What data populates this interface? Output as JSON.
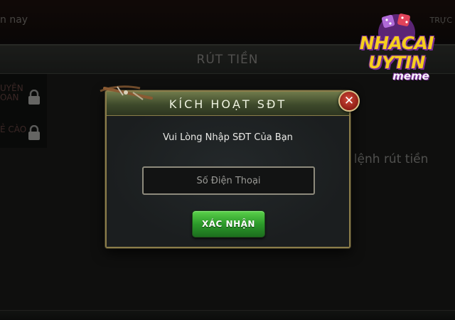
{
  "background": {
    "top_left_text": "n nay",
    "top_right_text": "TRỰC",
    "top_center_text": "",
    "withdraw_title": "RÚT TIỀN",
    "side_menu": [
      {
        "label": "UYÊN\nOAN",
        "icon": "lock-icon"
      },
      {
        "label": "Ẻ CÀO",
        "icon": "lock-icon"
      }
    ],
    "body_text": "o lệnh rút tiền"
  },
  "dialog": {
    "title": "KÍCH HOẠT SĐT",
    "instruction": "Vui Lòng Nhập SĐT Của Bạn",
    "phone_placeholder": "Số Điện Thoại",
    "phone_value": "",
    "confirm_label": "XÁC NHẬN",
    "close_symbol": "✕"
  },
  "logo": {
    "line1": "NHACAI",
    "line2": "UYTIN",
    "line3": "meme"
  },
  "colors": {
    "accent_gold": "#8b7d4a",
    "header_green": "#3e4a2b",
    "confirm_green": "#2c9a2a",
    "close_red": "#8e1d15",
    "logo_yellow": "#f6cf1e",
    "logo_purple": "#7a2d97"
  }
}
